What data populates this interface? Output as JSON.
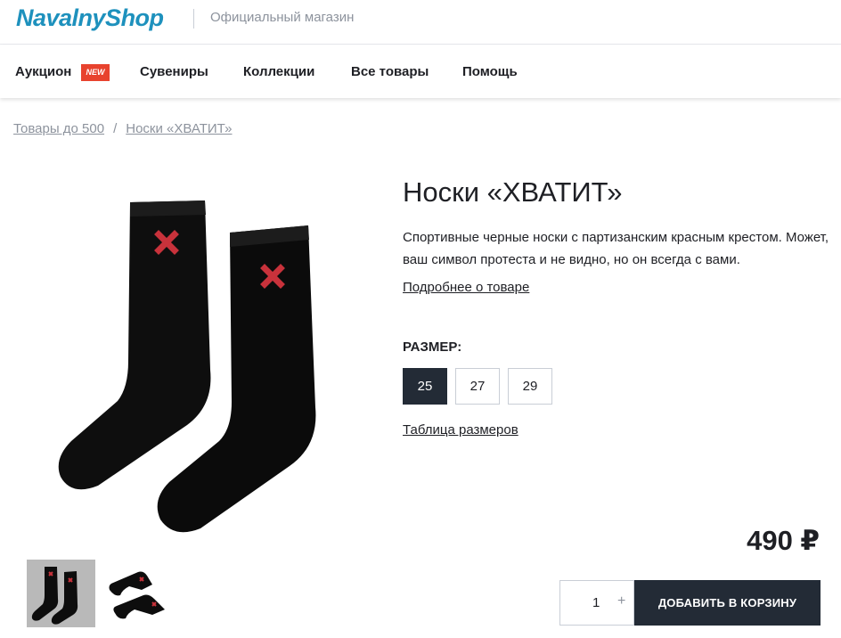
{
  "header": {
    "logo": "NavalnyShop",
    "tagline": "Официальный магазин"
  },
  "nav": {
    "items": [
      {
        "label": "Аукцион",
        "badge": "NEW"
      },
      {
        "label": "Сувениры"
      },
      {
        "label": "Коллекции"
      },
      {
        "label": "Все товары"
      },
      {
        "label": "Помощь"
      }
    ]
  },
  "breadcrumb": {
    "items": [
      "Товары до 500",
      "Носки «ХВАТИТ»"
    ],
    "separator": "/"
  },
  "product": {
    "title": "Носки «ХВАТИТ»",
    "description": "Спортивные черные носки с партизанским красным крестом. Может, ваш символ протеста и не видно, но он всегда с вами.",
    "more_link": "Подробнее о товаре",
    "size_label": "РАЗМЕР:",
    "sizes": [
      "25",
      "27",
      "29"
    ],
    "selected_size": "25",
    "size_table_link": "Таблица размеров",
    "price": "490 ₽",
    "quantity": "1",
    "qty_plus": "+",
    "add_to_cart": "ДОБАВИТЬ В КОРЗИНУ"
  },
  "colors": {
    "brand": "#1e91bd",
    "badge": "#e8432e",
    "dark_button": "#232b36",
    "sock": "#0d0d0d",
    "cross": "#c8323b"
  },
  "icons": {
    "main_image": "socks-pair-photo",
    "thumbnails": [
      "socks-pair-thumbnail",
      "socks-flat-thumbnail"
    ]
  }
}
